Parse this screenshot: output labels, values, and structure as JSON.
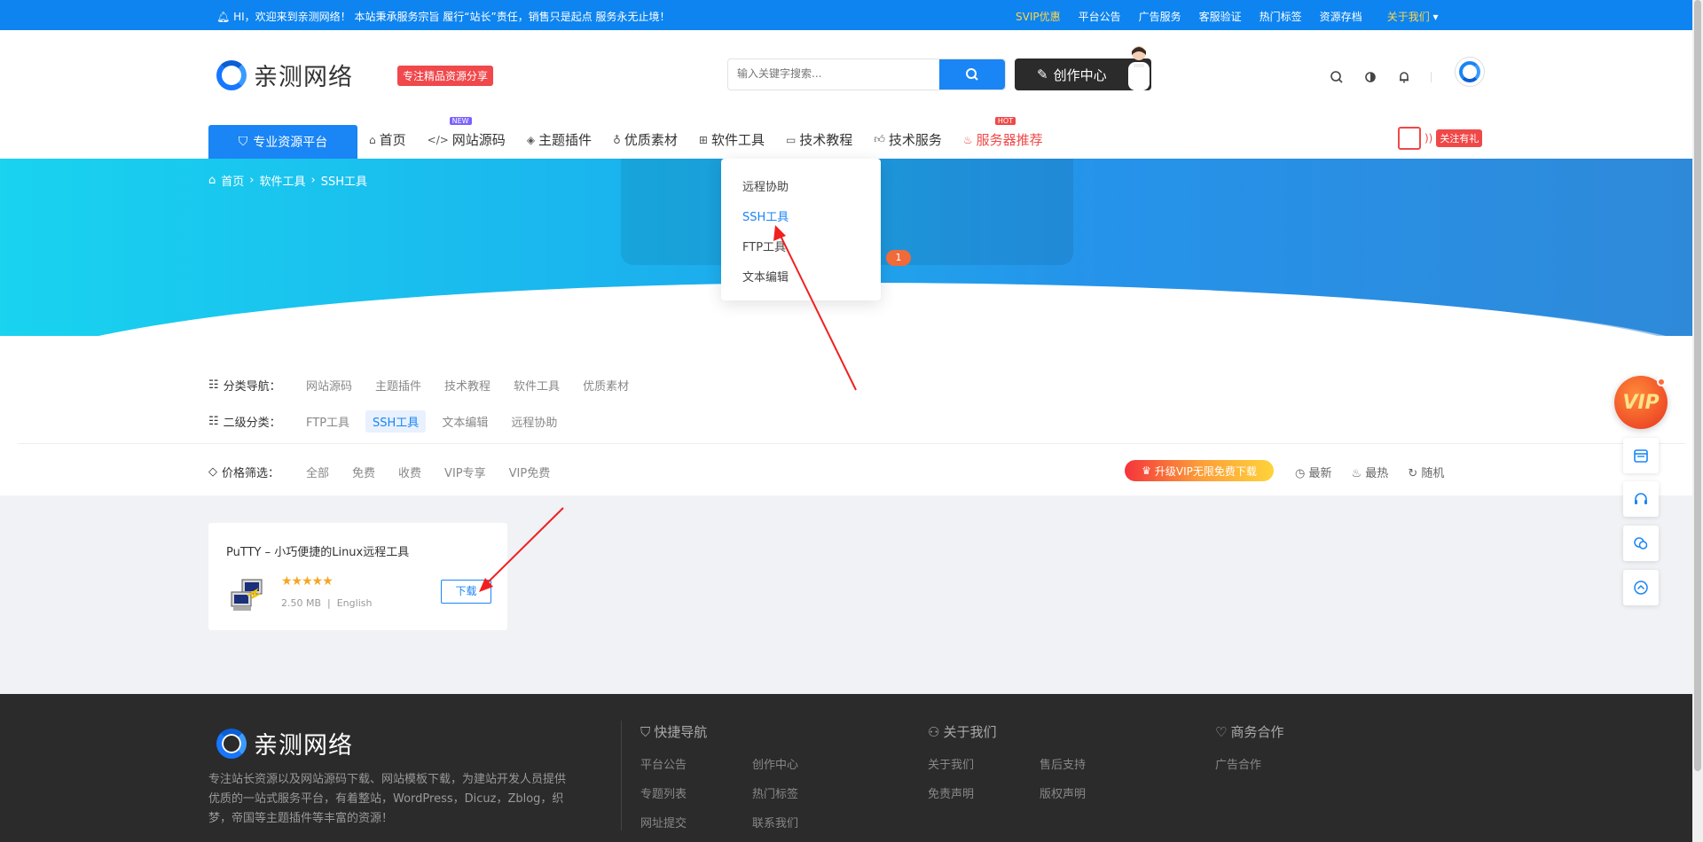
{
  "topbar": {
    "welcome": "HI，欢迎来到亲测网络！ 本站秉承服务宗旨 履行“站长”责任，销售只是起点 服务永无止境！",
    "links": [
      "SVIP优惠",
      "平台公告",
      "广告服务",
      "客服验证",
      "热门标签",
      "资源存档"
    ],
    "about": "关于我们"
  },
  "header": {
    "logo_text": "亲测网络",
    "tag": "专注精品资源分享",
    "search_placeholder": "输入关键字搜索...",
    "create_label": "创作中心",
    "platform_label": "专业资源平台",
    "follow_label": "关注有礼"
  },
  "nav": [
    {
      "label": "首页",
      "icon": "home-icon",
      "sup": ""
    },
    {
      "label": "网站源码",
      "icon": "code-icon",
      "sup": "NEW"
    },
    {
      "label": "主题插件",
      "icon": "layers-icon",
      "sup": ""
    },
    {
      "label": "优质素材",
      "icon": "bulb-icon",
      "sup": ""
    },
    {
      "label": "软件工具",
      "icon": "grid-icon",
      "sup": ""
    },
    {
      "label": "技术教程",
      "icon": "monitor-icon",
      "sup": ""
    },
    {
      "label": "技术服务",
      "icon": "thumb-icon",
      "sup": ""
    },
    {
      "label": "服务器推荐",
      "icon": "fire-icon",
      "sup": "HOT"
    }
  ],
  "colors": {
    "accent": "#1a85f5",
    "hot": "#f04848",
    "new": "#7b61ff"
  },
  "breadcrumb": [
    "首页",
    "软件工具",
    "SSH工具"
  ],
  "dropdown": [
    "远程协助",
    "SSH工具",
    "FTP工具",
    "文本编辑"
  ],
  "badge_count": "1",
  "filters": {
    "category_label": "分类导航：",
    "categories": [
      "网站源码",
      "主题插件",
      "技术教程",
      "软件工具",
      "优质素材"
    ],
    "sub_label": "二级分类：",
    "subs": [
      "FTP工具",
      "SSH工具",
      "文本编辑",
      "远程协助"
    ],
    "price_label": "价格筛选：",
    "prices": [
      "全部",
      "免费",
      "收费",
      "VIP专享",
      "VIP免费"
    ],
    "vip_upgrade": "升级VIP无限免费下载",
    "sorts": [
      "最新",
      "最热",
      "随机"
    ]
  },
  "card": {
    "title": "PuTTY – 小巧便捷的Linux远程工具",
    "stars": "★★★★★",
    "size": "2.50 MB",
    "lang": "English",
    "download": "下载"
  },
  "footer": {
    "logo_text": "亲测网络",
    "desc": "专注站长资源以及网站源码下载、网站模板下载，为建站开发人员提供优质的一站式服务平台，有着整站，WordPress，Dicuz，Zblog，织梦，帝国等主题插件等丰富的资源！",
    "nav_title": "快捷导航",
    "nav_links": [
      "平台公告",
      "创作中心",
      "专题列表",
      "热门标签",
      "网址提交",
      "联系我们"
    ],
    "about_title": "关于我们",
    "about_links": [
      "关于我们",
      "售后支持",
      "免责声明",
      "版权声明"
    ],
    "biz_title": "商务合作",
    "biz_links": [
      "广告合作"
    ]
  },
  "vip_ball": "VIP"
}
